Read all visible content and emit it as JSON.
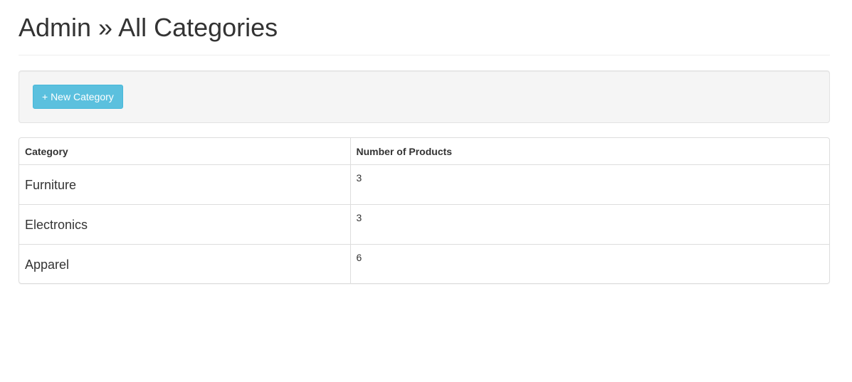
{
  "header": {
    "title": "Admin » All Categories"
  },
  "toolbar": {
    "new_label": "+ New Category"
  },
  "table": {
    "columns": [
      "Category",
      "Number of Products"
    ],
    "rows": [
      {
        "category": "Furniture",
        "count": "3"
      },
      {
        "category": "Electronics",
        "count": "3"
      },
      {
        "category": "Apparel",
        "count": "6"
      }
    ]
  },
  "colors": {
    "button_bg": "#5bc0de",
    "well_bg": "#f5f5f5",
    "text": "#333333"
  }
}
